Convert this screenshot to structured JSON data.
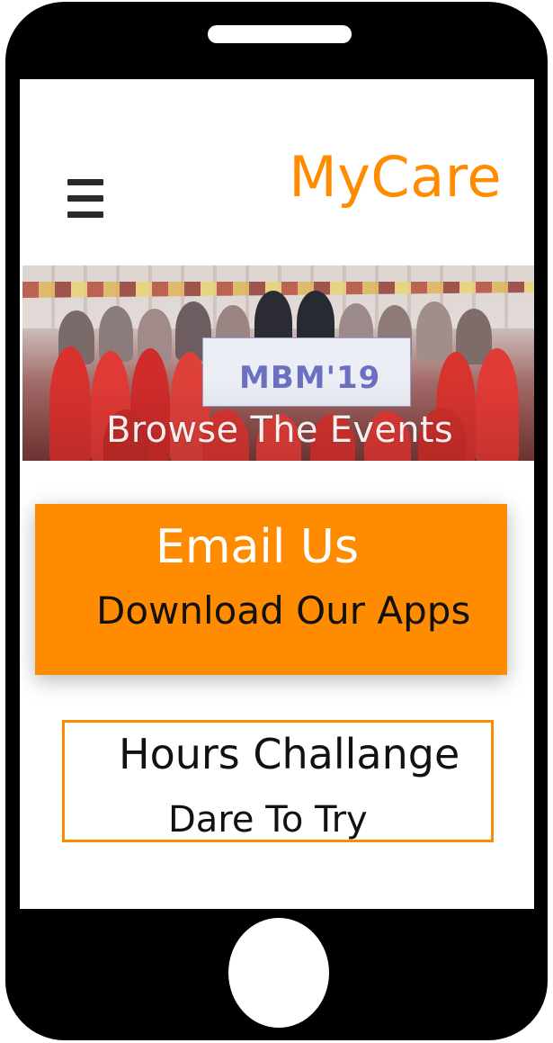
{
  "header": {
    "brand": "MyCare",
    "menu_icon": "hamburger-menu-icon"
  },
  "hero": {
    "caption": "Browse The Events",
    "banner_text": "MBM'19"
  },
  "orange_card": {
    "title": "Email Us",
    "subtitle": "Download Our Apps"
  },
  "challenge_card": {
    "title": "Hours Challange",
    "subtitle": "Dare To Try"
  },
  "colors": {
    "accent": "#fe8b00",
    "phone_frame": "#000000",
    "text": "#111111"
  }
}
